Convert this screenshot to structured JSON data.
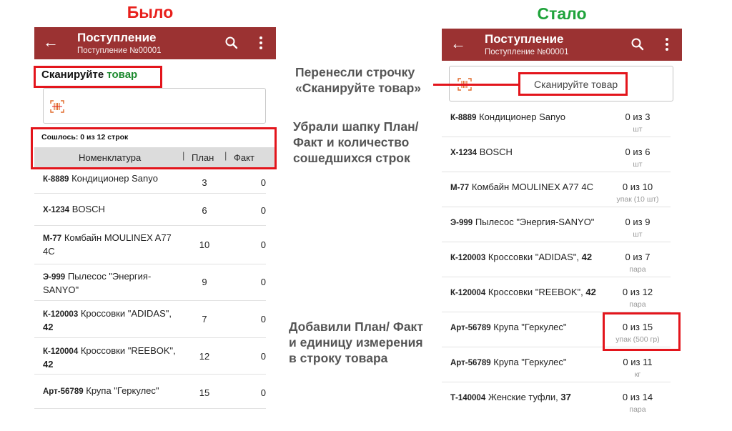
{
  "headings": {
    "before": "Было",
    "after": "Стало"
  },
  "appbar": {
    "title": "Поступление",
    "subtitle": "Поступление №00001"
  },
  "before": {
    "scan_prompt_prefix": "Сканируйте",
    "scan_prompt_accent": "товар",
    "summary": "Сошлось: 0 из 12 строк",
    "columns": {
      "name": "Номенклатура",
      "plan": "План",
      "fact": "Факт",
      "separator": "|"
    },
    "rows": [
      {
        "code": "К-8889",
        "name": "Кондиционер Sanyo",
        "plan": "3",
        "fact": "0"
      },
      {
        "code": "Х-1234",
        "name": "BOSCH",
        "plan": "6",
        "fact": "0"
      },
      {
        "code": "М-77",
        "name": "Комбайн MOULINEX A77",
        "name2": "4C",
        "plan": "10",
        "fact": "0"
      },
      {
        "code": "Э-999",
        "name": "Пылесос \"Энергия-",
        "name2": "SANYO\"",
        "plan": "9",
        "fact": "0"
      },
      {
        "code": "К-120003",
        "name": "Кроссовки \"ADIDAS\",",
        "name2_strong": "42",
        "plan": "7",
        "fact": "0"
      },
      {
        "code": "К-120004",
        "name": "Кроссовки \"REEBOK\",",
        "name2_strong": "42",
        "plan": "12",
        "fact": "0"
      },
      {
        "code": "Арт-56789",
        "name": "Крупа \"Геркулес\"",
        "plan": "15",
        "fact": "0"
      }
    ]
  },
  "after": {
    "scan_placeholder": "Сканируйте товар",
    "rows": [
      {
        "code": "К-8889",
        "name": "Кондиционер Sanyo",
        "qty": "0 из 3",
        "unit": "шт"
      },
      {
        "code": "Х-1234",
        "name": "BOSCH",
        "qty": "0 из 6",
        "unit": "шт"
      },
      {
        "code": "М-77",
        "name": "Комбайн MOULINEX A77 4C",
        "qty": "0 из 10",
        "unit": "упак (10 шт)"
      },
      {
        "code": "Э-999",
        "name": "Пылесос \"Энергия-SANYO\"",
        "qty": "0 из 9",
        "unit": "шт"
      },
      {
        "code": "К-120003",
        "name": "Кроссовки \"ADIDAS\",",
        "strong": "42",
        "qty": "0 из 7",
        "unit": "пара"
      },
      {
        "code": "К-120004",
        "name": "Кроссовки \"REEBOK\",",
        "strong": "42",
        "qty": "0 из 12",
        "unit": "пара"
      },
      {
        "code": "Арт-56789",
        "name": "Крупа \"Геркулес\"",
        "qty": "0 из 15",
        "unit": "упак (500 гр)"
      },
      {
        "code": "Арт-56789",
        "name": "Крупа \"Геркулес\"",
        "qty": "0 из 11",
        "unit": "кг"
      },
      {
        "code": "Т-140004",
        "name": "Женские туфли,",
        "strong": "37",
        "qty": "0 из 14",
        "unit": "пара"
      }
    ]
  },
  "notes": {
    "moved_line1": "Перенесли строчку",
    "moved_line2": "«Сканируйте товар»",
    "removed_line1": "Убрали шапку План/",
    "removed_line2": "Факт и количество",
    "removed_line3": "сошедшихся строк",
    "added_line1": "Добавили План/ Факт",
    "added_line2": "и единицу измерения",
    "added_line3": "в строку товара"
  },
  "colors": {
    "appbar": "#9b3232",
    "highlight": "#e3151c",
    "before_heading": "#e8201c",
    "after_heading": "#1fa33b",
    "accent_text": "#1d8a2f"
  }
}
